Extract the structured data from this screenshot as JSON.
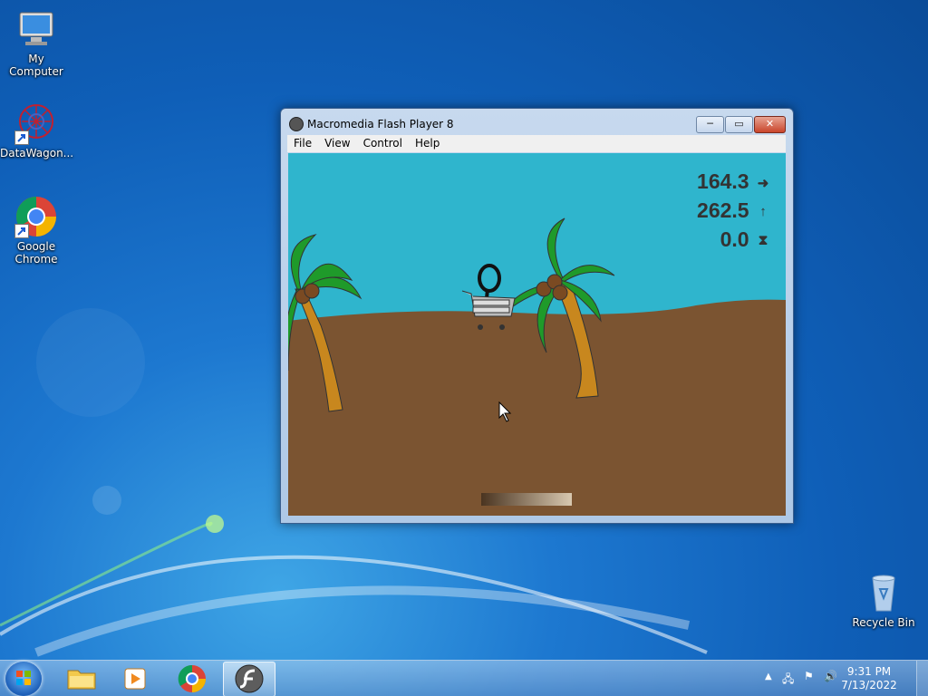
{
  "desktop": {
    "icons": [
      {
        "label": "My Computer",
        "icon": "computer-icon"
      },
      {
        "label": "DataWagon...",
        "icon": "datawagon-icon"
      },
      {
        "label": "Google Chrome",
        "icon": "chrome-icon"
      },
      {
        "label": "Recycle Bin",
        "icon": "recycle-bin-icon"
      }
    ]
  },
  "window": {
    "title": "Macromedia Flash Player 8",
    "controls": {
      "minimize": "─",
      "maximize": "▭",
      "close": "✕"
    },
    "menu": [
      "File",
      "View",
      "Control",
      "Help"
    ]
  },
  "game": {
    "stats": [
      {
        "value": "164.3",
        "unit_icon": "arrow-right-icon",
        "glyph": "➜"
      },
      {
        "value": "262.5",
        "unit_icon": "arrow-up-icon",
        "glyph": "↑"
      },
      {
        "value": "0.0",
        "unit_icon": "hourglass-icon",
        "glyph": "⧗"
      }
    ],
    "colors": {
      "sky": "#2fb5cd",
      "ground": "#7b5431",
      "palm_leaf": "#1f9a2a",
      "trunk": "#c8871e"
    }
  },
  "taskbar": {
    "clock_time": "9:31 PM",
    "clock_date": "7/13/2022",
    "pinned": [
      "start-orb",
      "file-explorer",
      "media-player",
      "google-chrome",
      "flash-player"
    ]
  }
}
